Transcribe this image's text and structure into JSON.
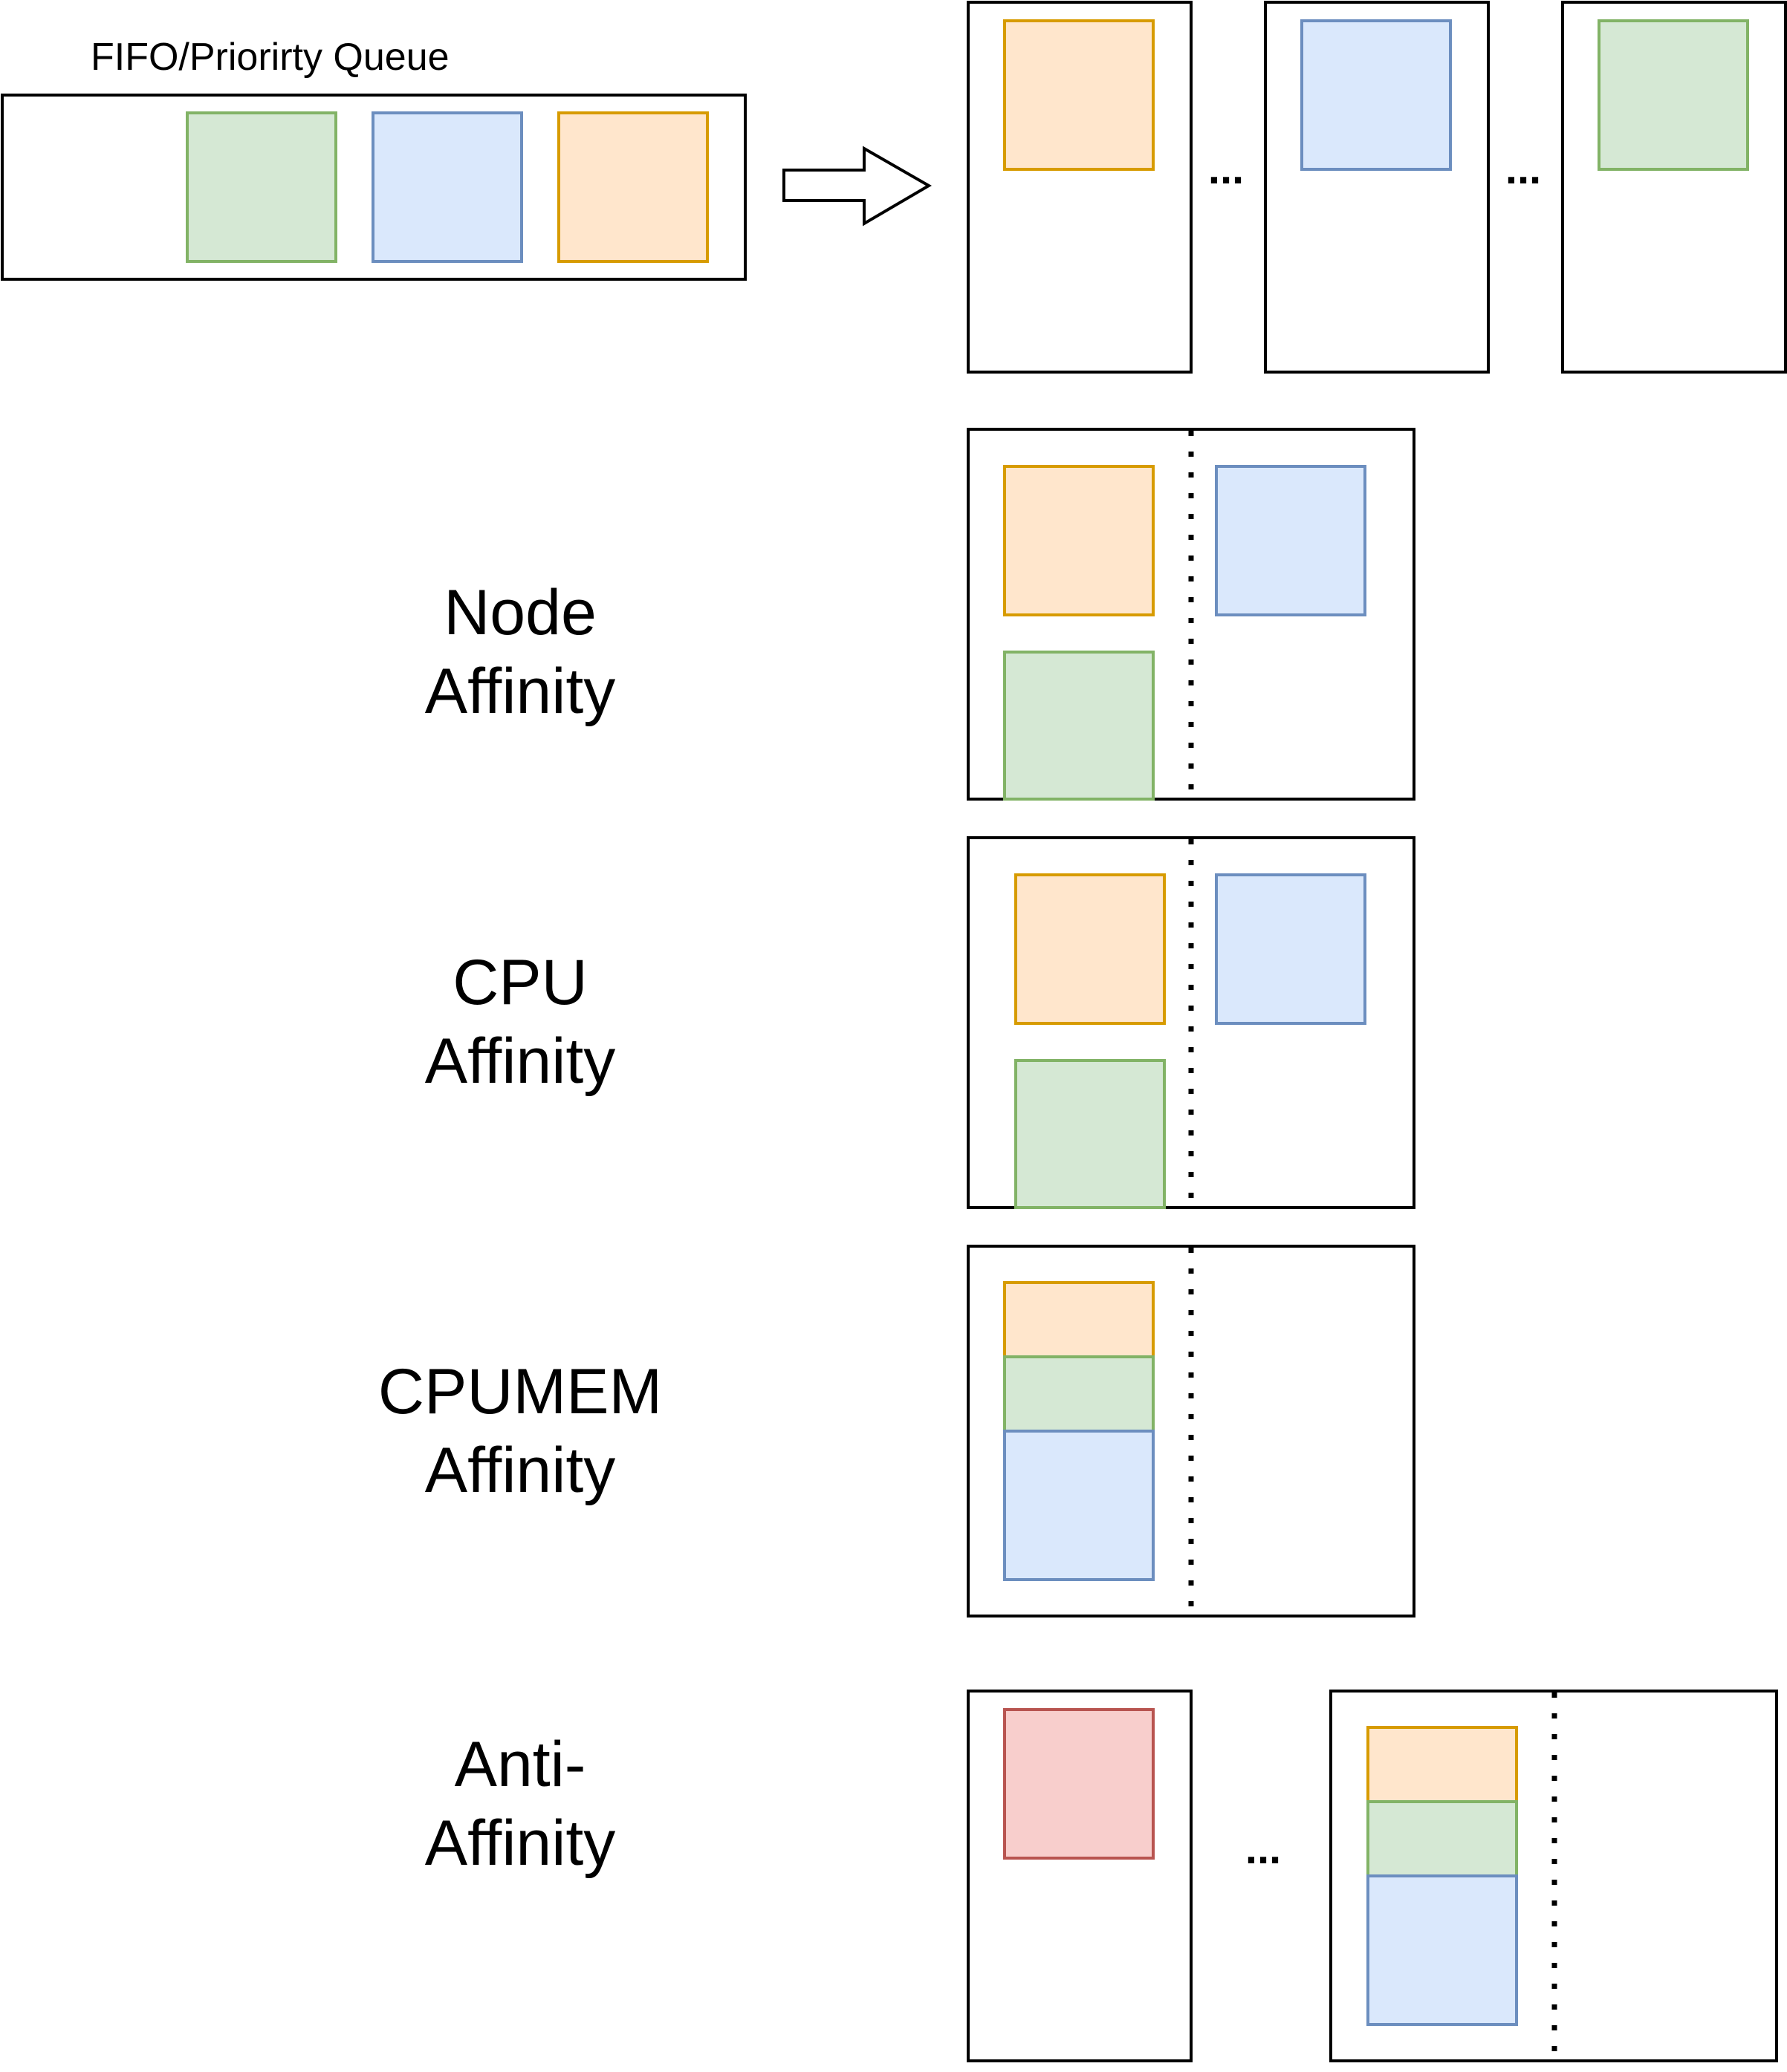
{
  "title": "FIFO/Priorirty Queue",
  "ellipsis": "...",
  "rows": {
    "node": {
      "line1": "Node",
      "line2": "Affinity"
    },
    "cpu": {
      "line1": "CPU",
      "line2": "Affinity"
    },
    "cpumem": {
      "line1": "CPUMEM",
      "line2": "Affinity"
    },
    "anti": {
      "line1": "Anti-",
      "line2": "Affinity"
    }
  },
  "colors": {
    "green_fill": "#d5e8d4",
    "green_stroke": "#82b366",
    "blue_fill": "#dae8fc",
    "blue_stroke": "#6c8ebf",
    "orange_fill": "#ffe6cc",
    "orange_stroke": "#d79b00",
    "red_fill": "#f8cecc",
    "red_stroke": "#b85450",
    "line": "#000000"
  }
}
